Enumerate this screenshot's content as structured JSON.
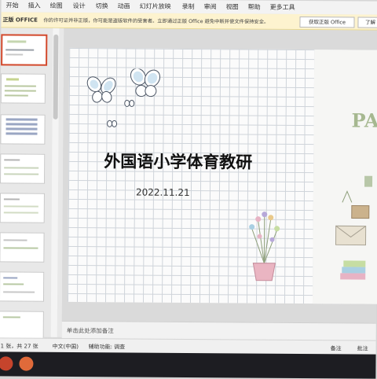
{
  "ribbon": {
    "tabs": [
      "开始",
      "插入",
      "绘图",
      "设计",
      "切换",
      "动画",
      "幻灯片放映",
      "录制",
      "审阅",
      "视图",
      "帮助",
      "更多工具"
    ]
  },
  "warning": {
    "title": "正版 OFFICE",
    "message": "你的许可证并非正版，你可能是盗版软件的受害者。立即通过正版 Office 避免中断并使文件保持安全。",
    "primary_button": "获取正版 Office",
    "secondary_button": "了解"
  },
  "slide": {
    "title": "外国语小学体育教研",
    "date": "2022.11.21",
    "side_text": "PA"
  },
  "notes": {
    "placeholder": "单击此处添加备注"
  },
  "status": {
    "slide_count": "1 张，共 27 张",
    "language": "中文(中国)",
    "accessibility": "辅助功能: 调查",
    "notes_toggle": "备注",
    "comments_toggle": "批注"
  },
  "thumbnails": {
    "count": 7,
    "selected_index": 0
  },
  "colors": {
    "accent": "#d2482b",
    "warning_bg": "#fdf3cf",
    "taskbar": "#1d1d22"
  }
}
